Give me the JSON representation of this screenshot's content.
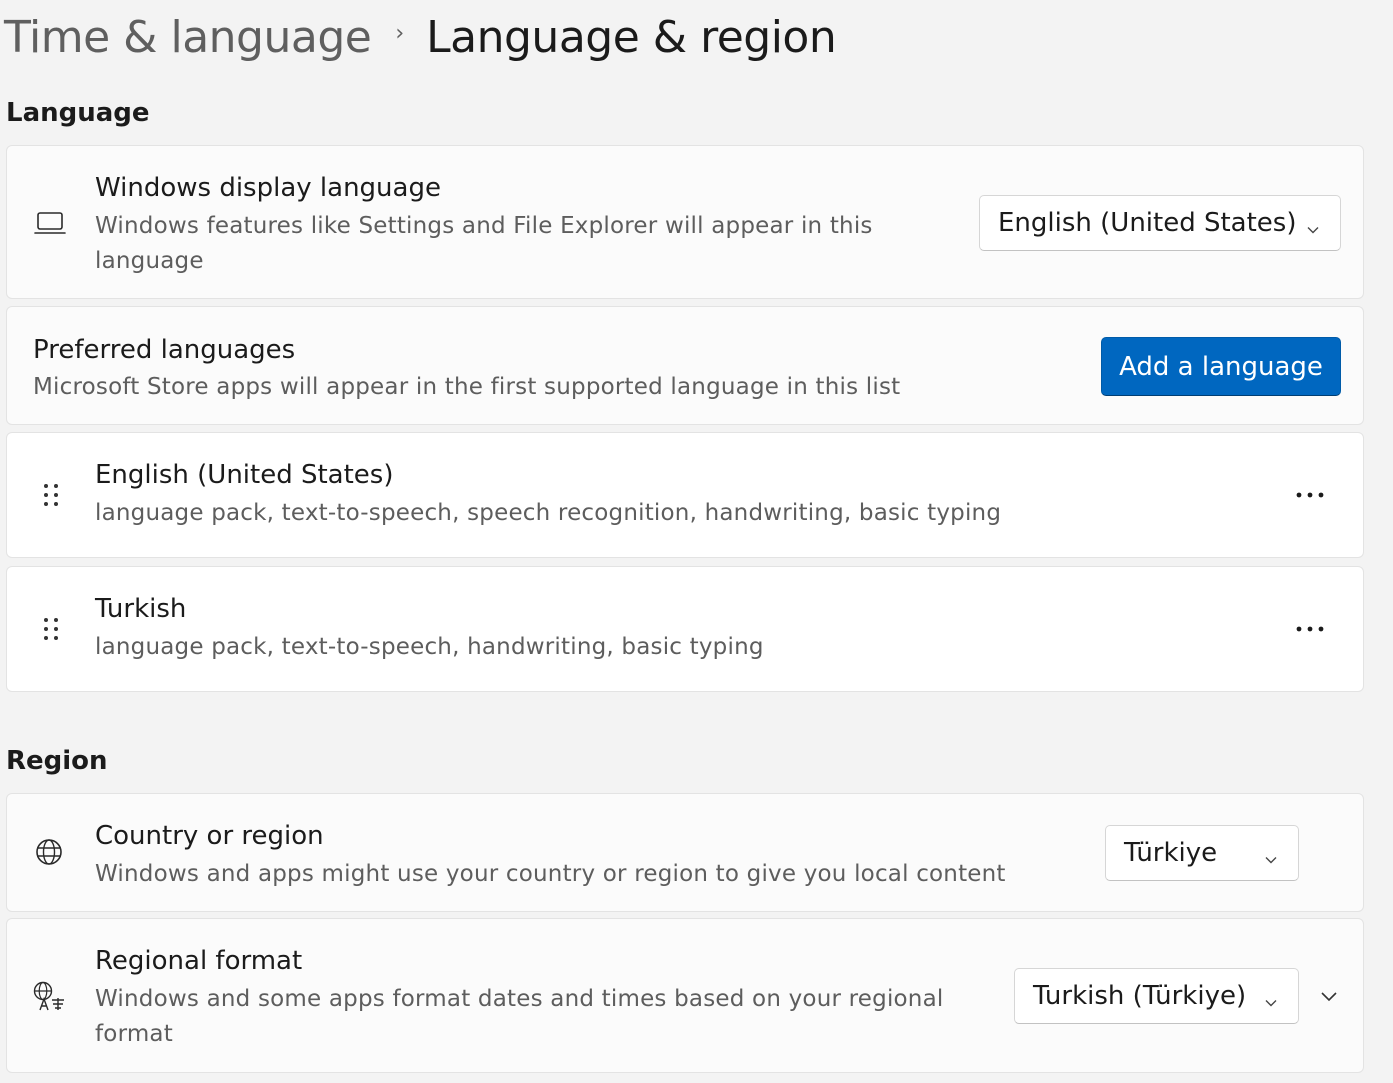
{
  "breadcrumb": {
    "parent": "Time & language",
    "separator": "›",
    "current": "Language & region"
  },
  "language_section": {
    "title": "Language",
    "display_language": {
      "icon": "laptop-icon",
      "title": "Windows display language",
      "description": "Windows features like Settings and File Explorer will appear in this language",
      "selected": "English (United States)"
    },
    "preferred": {
      "title": "Preferred languages",
      "description": "Microsoft Store apps will appear in the first supported language in this list",
      "button_label": "Add a language"
    },
    "languages": [
      {
        "name": "English (United States)",
        "features": "language pack, text-to-speech, speech recognition, handwriting, basic typing",
        "more_label": "•••"
      },
      {
        "name": "Turkish",
        "features": "language pack, text-to-speech, handwriting, basic typing",
        "more_label": "•••"
      }
    ]
  },
  "region_section": {
    "title": "Region",
    "country": {
      "icon": "globe-icon",
      "title": "Country or region",
      "description": "Windows and apps might use your country or region to give you local content",
      "selected": "Türkiye"
    },
    "format": {
      "icon": "regional-format-icon",
      "title": "Regional format",
      "description": "Windows and some apps format dates and times based on your regional format",
      "selected": "Turkish (Türkiye)"
    }
  },
  "colors": {
    "accent": "#0067c0",
    "background": "#f3f3f3",
    "card": "#fbfbfb"
  }
}
